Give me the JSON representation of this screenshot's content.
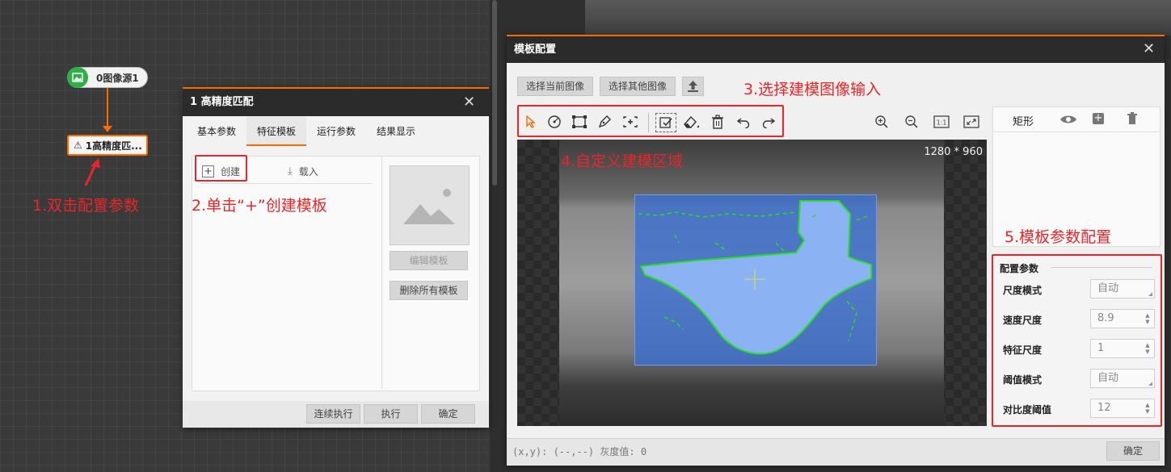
{
  "flow": {
    "node_source": "0图像源1",
    "node_match": "1高精度匹..."
  },
  "annotations": {
    "step1": "1.双击配置参数",
    "step2": "2.单击“+”创建模板",
    "step3": "3.选择建模图像输入",
    "step4": "4.自定义建模区域",
    "step5": "5.模板参数配置"
  },
  "match_dialog": {
    "title": "1 高精度匹配",
    "tabs": [
      "基本参数",
      "特征模板",
      "运行参数",
      "结果显示"
    ],
    "active_tab": 1,
    "create_label": "创建",
    "load_label": "载入",
    "edit_template": "编辑模板",
    "delete_all": "删除所有模板",
    "run_continuous": "连续执行",
    "run": "执行",
    "ok": "确定"
  },
  "template_dialog": {
    "title": "模板配置",
    "select_current": "选择当前图像",
    "select_other": "选择其他图像",
    "image_size": "1280 * 960",
    "shape_header": "矩形",
    "params_title": "配置参数",
    "params": [
      {
        "label": "尺度模式",
        "value": "自动",
        "kind": "select"
      },
      {
        "label": "速度尺度",
        "value": "8.9",
        "kind": "spin"
      },
      {
        "label": "特征尺度",
        "value": "1",
        "kind": "spin"
      },
      {
        "label": "阈值模式",
        "value": "自动",
        "kind": "select"
      },
      {
        "label": "对比度阈值",
        "value": "12",
        "kind": "spin"
      }
    ],
    "status": "(x,y): (--,--) 灰度值: 0",
    "ok": "确定"
  },
  "colors": {
    "accent": "#ff6a00",
    "annotation": "#e8262a",
    "node_green": "#2fae4a",
    "roi_blue": "#4a7fd6",
    "feature_green": "#22e022"
  }
}
